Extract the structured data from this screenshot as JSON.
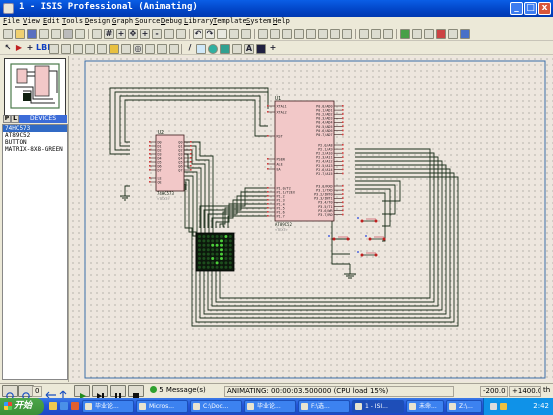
{
  "window": {
    "title": "1 - ISIS Professional (Animating)",
    "min": "_",
    "max": "□",
    "close": "x"
  },
  "menu": [
    "File",
    "View",
    "Edit",
    "Tools",
    "Design",
    "Graph",
    "Source",
    "Debug",
    "Library",
    "Template",
    "System",
    "Help"
  ],
  "panel": {
    "tab_p": "P",
    "tab_l": "L",
    "header": "DEVICES",
    "devices": [
      "74HC573",
      "AT89C52",
      "BUTTON",
      "MATRIX-8X8-GREEN"
    ]
  },
  "schematic": {
    "u1": {
      "ref": "U1",
      "part": "AT89C52",
      "sub": "<TEXT>",
      "left_pins": [
        "XTAL1",
        "XTAL2",
        "RST",
        "PSEN",
        "ALE",
        "EA",
        "P1.0/T2",
        "P1.1/T2EX",
        "P1.2",
        "P1.3",
        "P1.4",
        "P1.5",
        "P1.6",
        "P1.7"
      ],
      "right_pins": [
        "P0.0/AD0",
        "P0.1/AD1",
        "P0.2/AD2",
        "P0.3/AD3",
        "P0.4/AD4",
        "P0.5/AD5",
        "P0.6/AD6",
        "P0.7/AD7",
        "P2.0/A8",
        "P2.1/A9",
        "P2.2/A10",
        "P2.3/A11",
        "P2.4/A12",
        "P2.5/A13",
        "P2.6/A14",
        "P2.7/A15",
        "P3.0/RXD",
        "P3.1/TXD",
        "P3.2/INT0",
        "P3.3/INT1",
        "P3.4/T0",
        "P3.5/T1",
        "P3.6/WR",
        "P3.7/RD"
      ]
    },
    "u2": {
      "ref": "U2",
      "part": "74HC573",
      "sub": "<TEXT>",
      "left_pins": [
        "D0",
        "D1",
        "D2",
        "D3",
        "D4",
        "D5",
        "D6",
        "D7",
        "",
        "LE",
        "OE"
      ],
      "right_pins": [
        "Q0",
        "Q1",
        "Q2",
        "Q3",
        "Q4",
        "Q5",
        "Q6",
        "Q7"
      ]
    },
    "matrix": {
      "lit": [
        0,
        0,
        0,
        0,
        0,
        0,
        1,
        0,
        0,
        0,
        0,
        0,
        0,
        1,
        0,
        0,
        0,
        0,
        0,
        1,
        1,
        1,
        0,
        0,
        0,
        0,
        0,
        0,
        0,
        1,
        0,
        0,
        0,
        0,
        0,
        0,
        0,
        1,
        0,
        0,
        0,
        0,
        0,
        1,
        0,
        1,
        0,
        0,
        0,
        0,
        0,
        0,
        1,
        0,
        0,
        0,
        0,
        0,
        0,
        0,
        0,
        0,
        0,
        0
      ]
    }
  },
  "status": {
    "steps": "0",
    "messages": "5 Message(s)",
    "animating": "ANIMATING: 00:00:03.500000 (CPU load 15%)",
    "x": "-200.0",
    "y": "+1400.0",
    "unit": "th"
  },
  "taskbar": {
    "start": "开始",
    "items": [
      "毕业论...",
      "Micros...",
      "C:\\Doc...",
      "毕业论...",
      "F:\\选...",
      "1 - ISI...",
      "未命...",
      "Z:\\..."
    ],
    "clock": "2:42"
  },
  "colors": {
    "led_on": "#4ccf3a",
    "led_off": "#1d4d1d",
    "wire": "#1a2f1a",
    "chip": "#f2c8c8"
  }
}
